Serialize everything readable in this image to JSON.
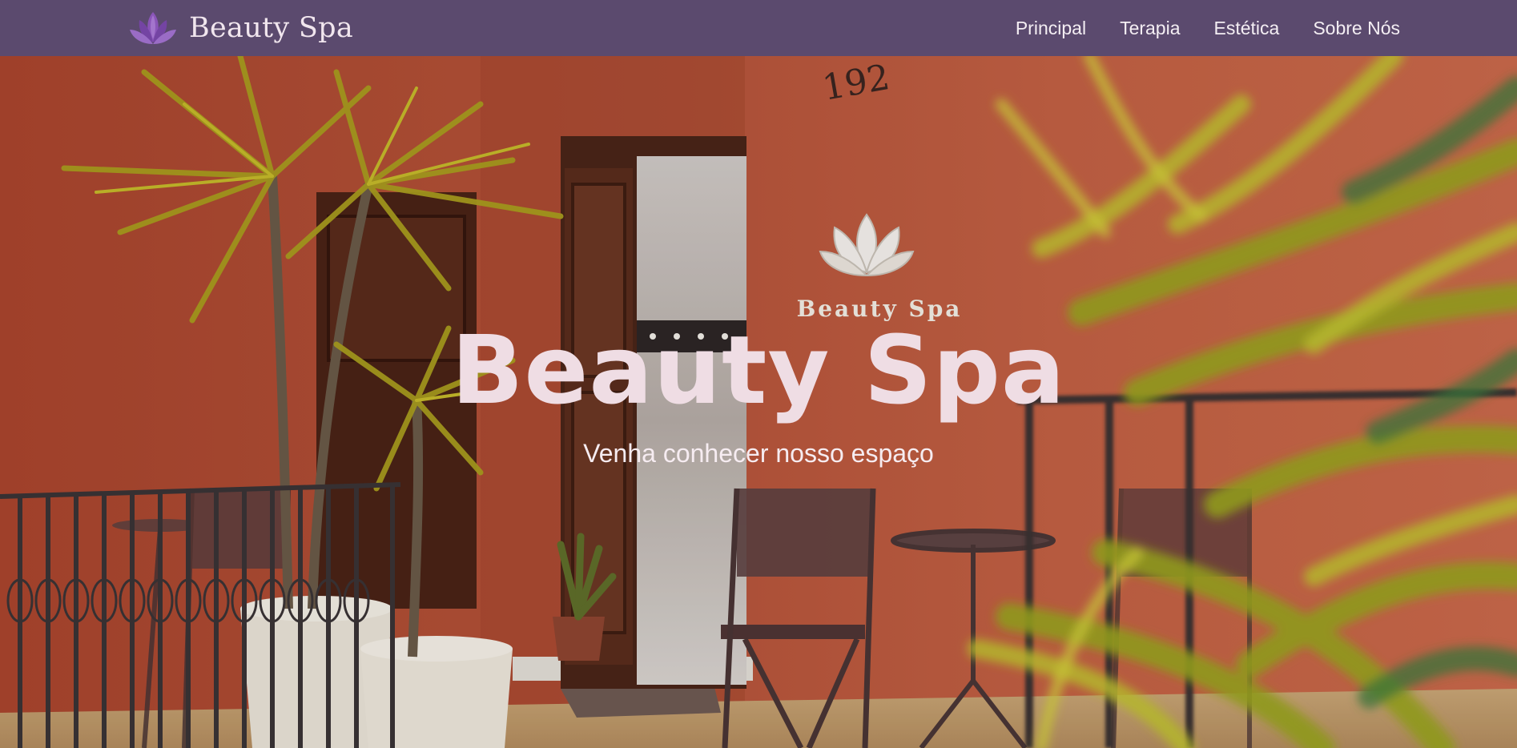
{
  "brand": {
    "name": "Beauty Spa",
    "logo_icon": "lotus-icon"
  },
  "nav": {
    "items": [
      {
        "label": "Principal"
      },
      {
        "label": "Terapia"
      },
      {
        "label": "Estética"
      },
      {
        "label": "Sobre Nós"
      }
    ]
  },
  "hero": {
    "title": "Beauty Spa",
    "subtitle": "Venha conhecer nosso espaço",
    "storefront_sign": "Beauty Spa",
    "door_number": "192"
  },
  "colors": {
    "navbar": "#5b4a6e",
    "wall": "#b85a3c",
    "hero_text": "#efdde4"
  }
}
